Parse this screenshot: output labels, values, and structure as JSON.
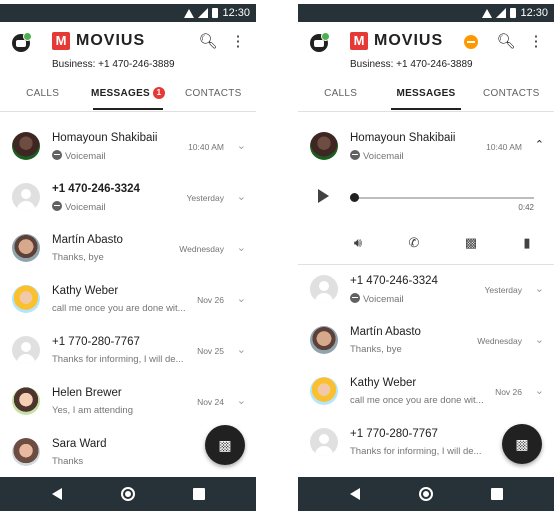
{
  "status_bar": {
    "time": "12:30"
  },
  "app": {
    "logo_text": "MOVIUS",
    "business_line": "Business: +1 470-246-3889"
  },
  "tabs": [
    {
      "label": "CALLS"
    },
    {
      "label": "MESSAGES",
      "badge": "1"
    },
    {
      "label": "CONTACTS"
    }
  ],
  "left_list": [
    {
      "name": "Homayoun Shakibaii",
      "sub": "Voicemail",
      "time": "10:40 AM"
    },
    {
      "name": "+1 470-246-3324",
      "sub": "Voicemail",
      "time": "Yesterday"
    },
    {
      "name": "Martín Abasto",
      "sub": "Thanks, bye",
      "time": "Wednesday"
    },
    {
      "name": "Kathy Weber",
      "sub": "call me once you are done wit...",
      "time": "Nov 26"
    },
    {
      "name": "+1 770-280-7767",
      "sub": "Thanks for informing, I will de...",
      "time": "Nov 25"
    },
    {
      "name": "Helen Brewer",
      "sub": "Yes, I am attending",
      "time": "Nov 24"
    },
    {
      "name": "Sara Ward",
      "sub": "Thanks",
      "time": ""
    }
  ],
  "right_list": [
    {
      "name": "Homayoun Shakibaii",
      "sub": "Voicemail",
      "time": "10:40 AM"
    },
    {
      "name": "+1 470-246-3324",
      "sub": "Voicemail",
      "time": "Yesterday"
    },
    {
      "name": "Martín Abasto",
      "sub": "Thanks, bye",
      "time": "Wednesday"
    },
    {
      "name": "Kathy Weber",
      "sub": "call me once you are done wit...",
      "time": "Nov 26"
    },
    {
      "name": "+1 770-280-7767",
      "sub": "Thanks for informing, I will de...",
      "time": ""
    }
  ],
  "player": {
    "duration": "0:42",
    "progress": 0.0
  },
  "icons": {
    "wifi": "wifi-icon",
    "signal": "signal-icon",
    "battery": "battery-icon",
    "search": "search-icon",
    "menu": "more-vert-icon",
    "voicemail": "voicemail-icon",
    "chevron_down": "chevron-down-icon",
    "chevron_up": "chevron-up-icon",
    "play": "play-icon",
    "speaker": "speaker-icon",
    "call": "call-icon",
    "message": "message-icon",
    "trash": "trash-icon",
    "compose": "compose-message-icon"
  },
  "colors": {
    "accent": "#212121",
    "brand": "#e53935",
    "badge": "#e53935",
    "dnd": "#ff9800",
    "system_bar": "#263238"
  }
}
